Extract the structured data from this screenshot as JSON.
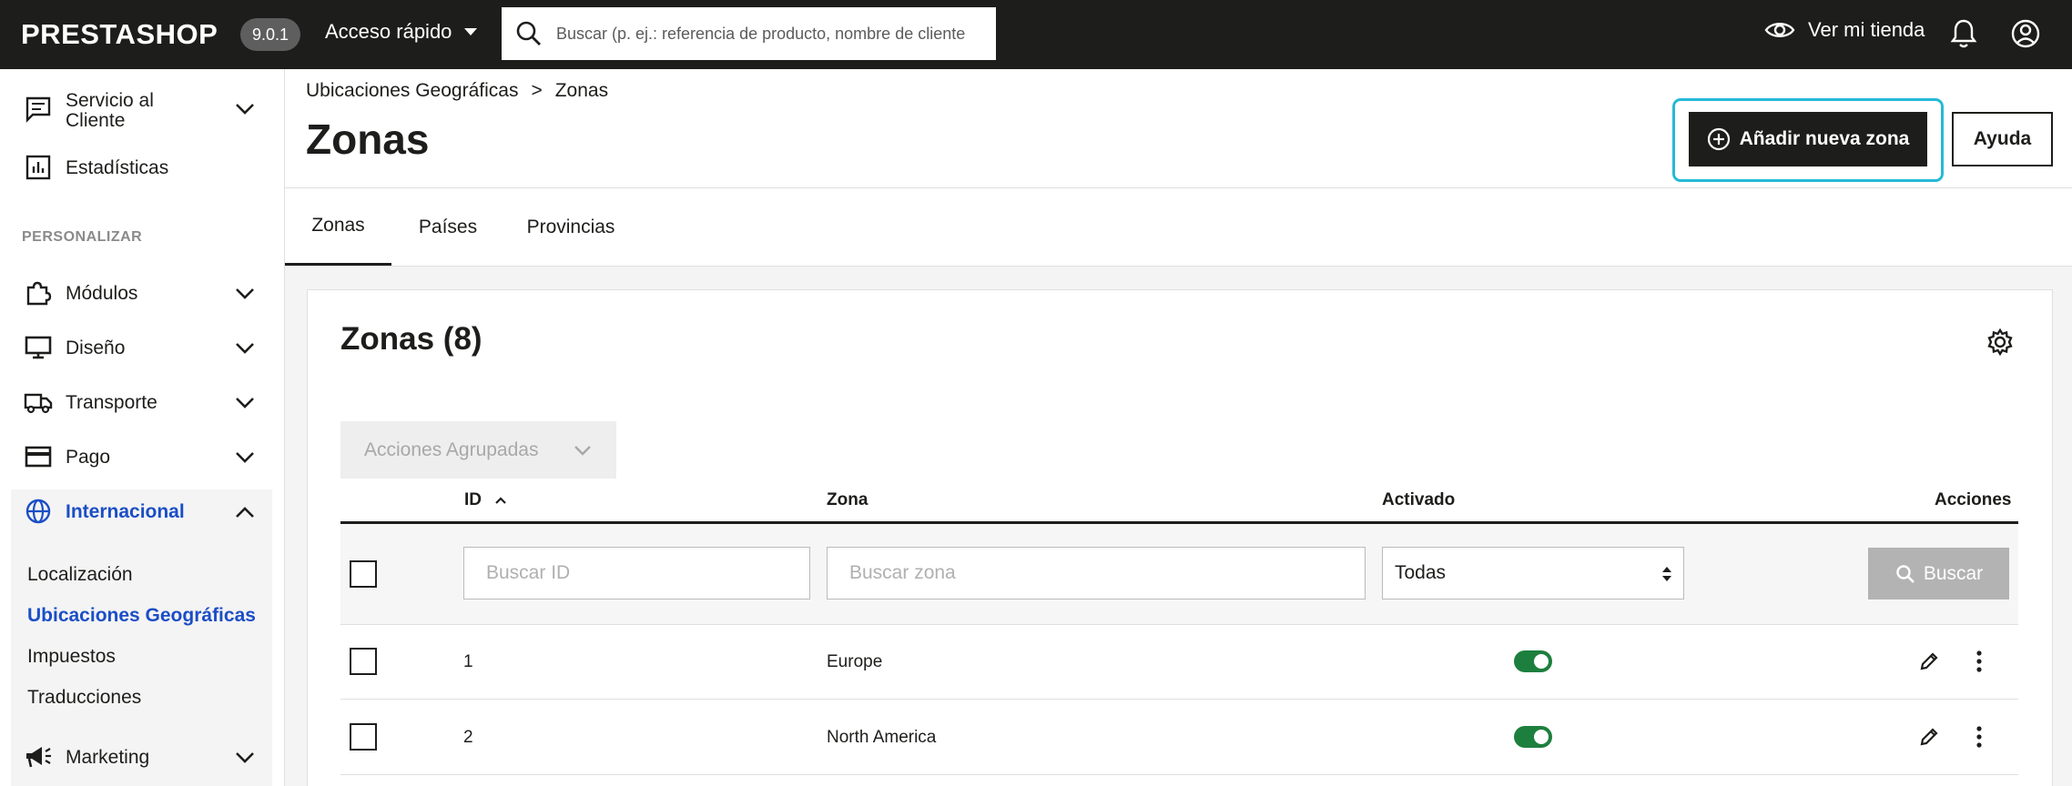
{
  "topbar": {
    "logo": "PRESTASHOP",
    "version": "9.0.1",
    "quick_access": "Acceso rápido",
    "search_placeholder": "Buscar (p. ej.: referencia de producto, nombre de cliente",
    "view_shop": "Ver mi tienda"
  },
  "sidebar": {
    "customer_service": "Servicio al Cliente",
    "stats": "Estadísticas",
    "section_label": "PERSONALIZAR",
    "modules": "Módulos",
    "design": "Diseño",
    "shipping": "Transporte",
    "payment": "Pago",
    "international": "Internacional",
    "sub_items": [
      "Localización",
      "Ubicaciones Geográficas",
      "Impuestos",
      "Traducciones"
    ],
    "marketing": "Marketing"
  },
  "header": {
    "breadcrumb": [
      "Ubicaciones Geográficas",
      ">",
      "Zonas"
    ],
    "title": "Zonas",
    "add_button": "Añadir nueva zona",
    "help_button": "Ayuda"
  },
  "tabs": [
    "Zonas",
    "Países",
    "Provincias"
  ],
  "grid": {
    "title": "Zonas (8)",
    "bulk_actions": "Acciones Agrupadas",
    "columns": {
      "id": "ID",
      "zone": "Zona",
      "enabled": "Activado",
      "actions": "Acciones"
    },
    "filters": {
      "id_placeholder": "Buscar ID",
      "zone_placeholder": "Buscar zona",
      "enabled_value": "Todas",
      "search_button": "Buscar"
    },
    "rows": [
      {
        "id": "1",
        "zone": "Europe",
        "enabled": true
      },
      {
        "id": "2",
        "zone": "North America",
        "enabled": true
      }
    ]
  },
  "colors": {
    "accent": "#25b9d7",
    "active_nav": "#1b4ec6",
    "toggle_on": "#1d7f3e",
    "dark": "#1d1d1b"
  }
}
